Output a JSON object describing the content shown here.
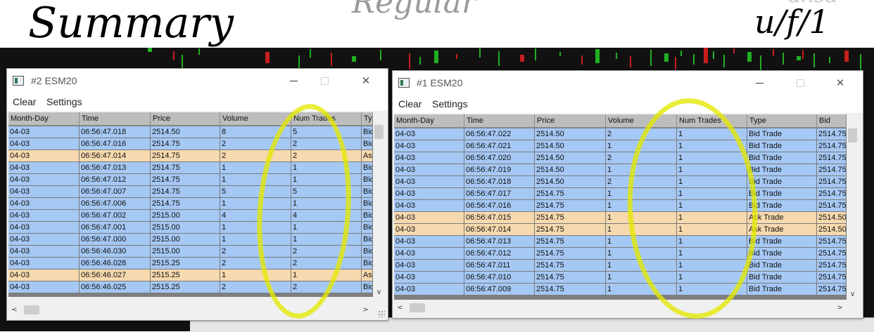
{
  "annotations": {
    "summary": "Summary",
    "regular": "Regular",
    "date": "u/f/1"
  },
  "colors": {
    "bid_row": "#a5c8f4",
    "ask_row": "#f6d9ae",
    "header": "#bdbdbd",
    "highlighter": "#e4e800"
  },
  "windows": [
    {
      "title": "#2 ESM20",
      "menu": [
        "Clear",
        "Settings"
      ],
      "icons": {
        "app": "app-window-icon",
        "min": "minimize-icon",
        "max": "maximize-icon",
        "close": "close-icon"
      },
      "columns": [
        "Month-Day",
        "Time",
        "Price",
        "Volume",
        "Num Trades",
        "Ty"
      ],
      "rows": [
        {
          "side": "bid",
          "cells": [
            "04-03",
            "06:56:47.018",
            "2514.50",
            "8",
            "5",
            "Bid"
          ]
        },
        {
          "side": "bid",
          "cells": [
            "04-03",
            "06:56:47.016",
            "2514.75",
            "2",
            "2",
            "Bid"
          ]
        },
        {
          "side": "ask",
          "cells": [
            "04-03",
            "06:56:47.014",
            "2514.75",
            "2",
            "2",
            "Ask"
          ]
        },
        {
          "side": "bid",
          "cells": [
            "04-03",
            "06:56:47.013",
            "2514.75",
            "1",
            "1",
            "Bid"
          ]
        },
        {
          "side": "bid",
          "cells": [
            "04-03",
            "06:56:47.012",
            "2514.75",
            "1",
            "1",
            "Bid"
          ]
        },
        {
          "side": "bid",
          "cells": [
            "04-03",
            "06:56:47.007",
            "2514.75",
            "5",
            "5",
            "Bid"
          ]
        },
        {
          "side": "bid",
          "cells": [
            "04-03",
            "06:56:47.006",
            "2514.75",
            "1",
            "1",
            "Bid"
          ]
        },
        {
          "side": "bid",
          "cells": [
            "04-03",
            "06:56:47.002",
            "2515.00",
            "4",
            "4",
            "Bid"
          ]
        },
        {
          "side": "bid",
          "cells": [
            "04-03",
            "06:56:47.001",
            "2515.00",
            "1",
            "1",
            "Bid"
          ]
        },
        {
          "side": "bid",
          "cells": [
            "04-03",
            "06:56:47.000",
            "2515.00",
            "1",
            "1",
            "Bid"
          ]
        },
        {
          "side": "bid",
          "cells": [
            "04-03",
            "06:56:46.030",
            "2515.00",
            "2",
            "2",
            "Bid"
          ]
        },
        {
          "side": "bid",
          "cells": [
            "04-03",
            "06:56:46.028",
            "2515.25",
            "2",
            "2",
            "Bid"
          ]
        },
        {
          "side": "ask",
          "cells": [
            "04-03",
            "06:56:46.027",
            "2515.25",
            "1",
            "1",
            "Ask"
          ]
        },
        {
          "side": "bid",
          "cells": [
            "04-03",
            "06:56:46.025",
            "2515.25",
            "2",
            "2",
            "Bid"
          ]
        }
      ]
    },
    {
      "title": "#1 ESM20",
      "menu": [
        "Clear",
        "Settings"
      ],
      "icons": {
        "app": "app-window-icon",
        "min": "minimize-icon",
        "max": "maximize-icon",
        "close": "close-icon"
      },
      "columns": [
        "Month-Day",
        "Time",
        "Price",
        "Volume",
        "Num Trades",
        "Type",
        "Bid"
      ],
      "rows": [
        {
          "side": "bid",
          "cells": [
            "04-03",
            "06:56:47.022",
            "2514.50",
            "2",
            "1",
            "Bid Trade",
            "2514.75"
          ]
        },
        {
          "side": "bid",
          "cells": [
            "04-03",
            "06:56:47.021",
            "2514.50",
            "1",
            "1",
            "Bid Trade",
            "2514.75"
          ]
        },
        {
          "side": "bid",
          "cells": [
            "04-03",
            "06:56:47.020",
            "2514.50",
            "2",
            "1",
            "Bid Trade",
            "2514.75"
          ]
        },
        {
          "side": "bid",
          "cells": [
            "04-03",
            "06:56:47.019",
            "2514.50",
            "1",
            "1",
            "Bid Trade",
            "2514.75"
          ]
        },
        {
          "side": "bid",
          "cells": [
            "04-03",
            "06:56:47.018",
            "2514.50",
            "2",
            "1",
            "Bid Trade",
            "2514.75"
          ]
        },
        {
          "side": "bid",
          "cells": [
            "04-03",
            "06:56:47.017",
            "2514.75",
            "1",
            "1",
            "Bid Trade",
            "2514.75"
          ]
        },
        {
          "side": "bid",
          "cells": [
            "04-03",
            "06:56:47.016",
            "2514.75",
            "1",
            "1",
            "Bid Trade",
            "2514.75"
          ]
        },
        {
          "side": "ask",
          "cells": [
            "04-03",
            "06:56:47.015",
            "2514.75",
            "1",
            "1",
            "Ask Trade",
            "2514.50"
          ]
        },
        {
          "side": "ask",
          "cells": [
            "04-03",
            "06:56:47.014",
            "2514.75",
            "1",
            "1",
            "Ask Trade",
            "2514.50"
          ]
        },
        {
          "side": "bid",
          "cells": [
            "04-03",
            "06:56:47.013",
            "2514.75",
            "1",
            "1",
            "Bid Trade",
            "2514.75"
          ]
        },
        {
          "side": "bid",
          "cells": [
            "04-03",
            "06:56:47.012",
            "2514.75",
            "1",
            "1",
            "Bid Trade",
            "2514.75"
          ]
        },
        {
          "side": "bid",
          "cells": [
            "04-03",
            "06:56:47.011",
            "2514.75",
            "1",
            "1",
            "Bid Trade",
            "2514.75"
          ]
        },
        {
          "side": "bid",
          "cells": [
            "04-03",
            "06:56:47.010",
            "2514.75",
            "1",
            "1",
            "Bid Trade",
            "2514.75"
          ]
        },
        {
          "side": "bid",
          "cells": [
            "04-03",
            "06:56:47.009",
            "2514.75",
            "1",
            "1",
            "Bid Trade",
            "2514.75"
          ]
        }
      ]
    }
  ],
  "background_chart": {
    "candle_colors": {
      "up": "#20b020",
      "down": "#c81e1e"
    }
  }
}
